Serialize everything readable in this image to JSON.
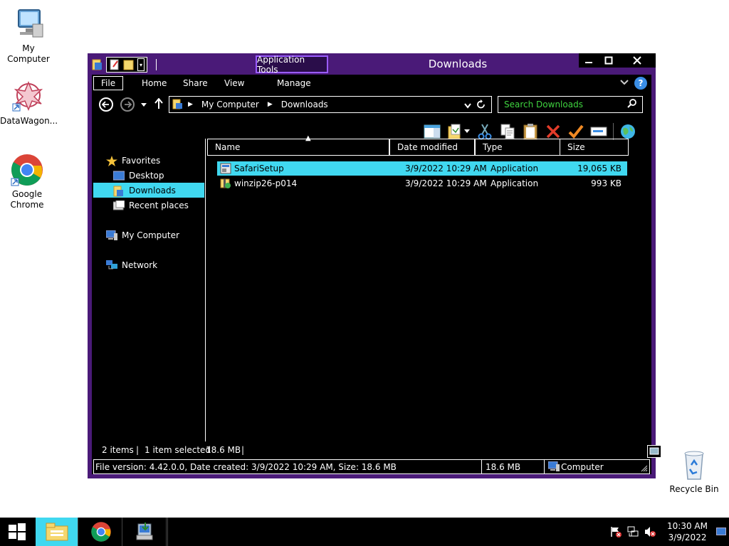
{
  "desktop": {
    "icons": [
      {
        "label": "My Computer"
      },
      {
        "label": "DataWagon..."
      },
      {
        "label": "Google Chrome"
      },
      {
        "label": "Recycle Bin"
      }
    ]
  },
  "window": {
    "title": "Downloads",
    "context_tab": "Application Tools",
    "controls": {
      "minimize": "—",
      "maximize": "□",
      "close": "✕"
    }
  },
  "ribbon": {
    "tabs": [
      "File",
      "Home",
      "Share",
      "View",
      "Manage"
    ]
  },
  "address": {
    "segments": [
      "My Computer",
      "Downloads"
    ]
  },
  "search": {
    "placeholder": "Search Downloads"
  },
  "nav_pane": {
    "favorites": "Favorites",
    "desktop": "Desktop",
    "downloads": "Downloads",
    "recent": "Recent places",
    "computer": "My Computer",
    "network": "Network"
  },
  "columns": [
    "Name",
    "Date modified",
    "Type",
    "Size"
  ],
  "files": [
    {
      "name": "SafariSetup",
      "date": "3/9/2022 10:29 AM",
      "type": "Application",
      "size": "19,065 KB",
      "selected": true
    },
    {
      "name": "winzip26-p014",
      "date": "3/9/2022 10:29 AM",
      "type": "Application",
      "size": "993 KB",
      "selected": false
    }
  ],
  "status": {
    "items": "2 items",
    "selected": "1 item selected",
    "selected_size": "18.6 MB",
    "details": "File version: 4.42.0.0, Date created: 3/9/2022 10:29 AM, Size: 18.6 MB",
    "size": "18.6 MB",
    "location": "Computer"
  },
  "taskbar": {
    "time": "10:30 AM",
    "date": "3/9/2022"
  },
  "colors": {
    "accent": "#4a1a78",
    "selection": "#40d8f0",
    "search_text": "#3fd33f"
  }
}
